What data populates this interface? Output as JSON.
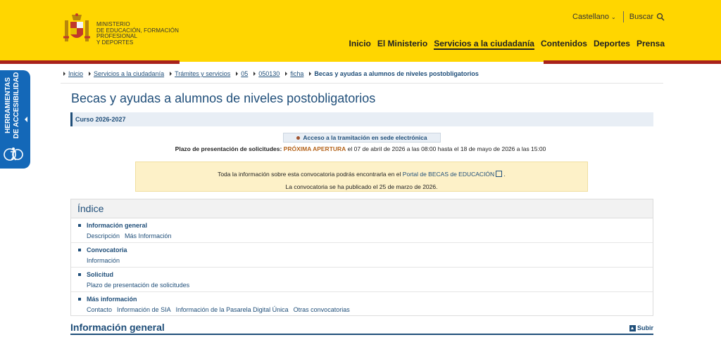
{
  "header": {
    "ministry": "MINISTERIO\nDE EDUCACIÓN, FORMACIÓN PROFESIONAL\nY DEPORTES",
    "language": "Castellano",
    "search_label": "Buscar",
    "nav": [
      "Inicio",
      "El Ministerio",
      "Servicios a la ciudadanía",
      "Contenidos",
      "Deportes",
      "Prensa"
    ],
    "active_nav_index": 2,
    "colors": {
      "brand_yellow": "#ffd600",
      "brand_red": "#a8211b"
    }
  },
  "accessibility": {
    "label": "HERRAMIENTAS DE ACCESIBILIDAD"
  },
  "breadcrumb": {
    "items": [
      "Inicio",
      "Servicios a la ciudadanía",
      "Trámites y servicios",
      "05",
      "050130",
      "ficha"
    ],
    "current": "Becas y ayudas a alumnos de niveles postobligatorios"
  },
  "page": {
    "title": "Becas y ayudas a alumnos de niveles postobligatorios",
    "course": "Curso 2026-2027",
    "access_button": "Acceso a la tramitación en sede electrónica",
    "plazo_label": "Plazo de presentación de solicitudes:",
    "plazo_status": "PRÓXIMA APERTURA",
    "plazo_text": "el 07 de abril de 2026 a las 08:00 hasta el 18 de mayo de 2026 a las 15:00",
    "notice_line1_pre": "Toda la información sobre esta convocatoria podrás encontrarla en el",
    "notice_link": "Portal de BECAS de EDUCACIÓN",
    "notice_line2": "La convocatoria se ha publicado el 25 de marzo de 2026."
  },
  "index": {
    "title": "Índice",
    "sections": [
      {
        "title": "Información general",
        "links": [
          "Descripción",
          "Más Información"
        ]
      },
      {
        "title": "Convocatoria",
        "links": [
          "Información"
        ]
      },
      {
        "title": "Solicitud",
        "links": [
          "Plazo de presentación de solicitudes"
        ]
      },
      {
        "title": "Más información",
        "links": [
          "Contacto",
          "Información de SIA",
          "Información de la Pasarela Digital Única",
          "Otras convocatorias"
        ]
      }
    ]
  },
  "info_general": {
    "title": "Información general",
    "up_label": "Subir"
  }
}
